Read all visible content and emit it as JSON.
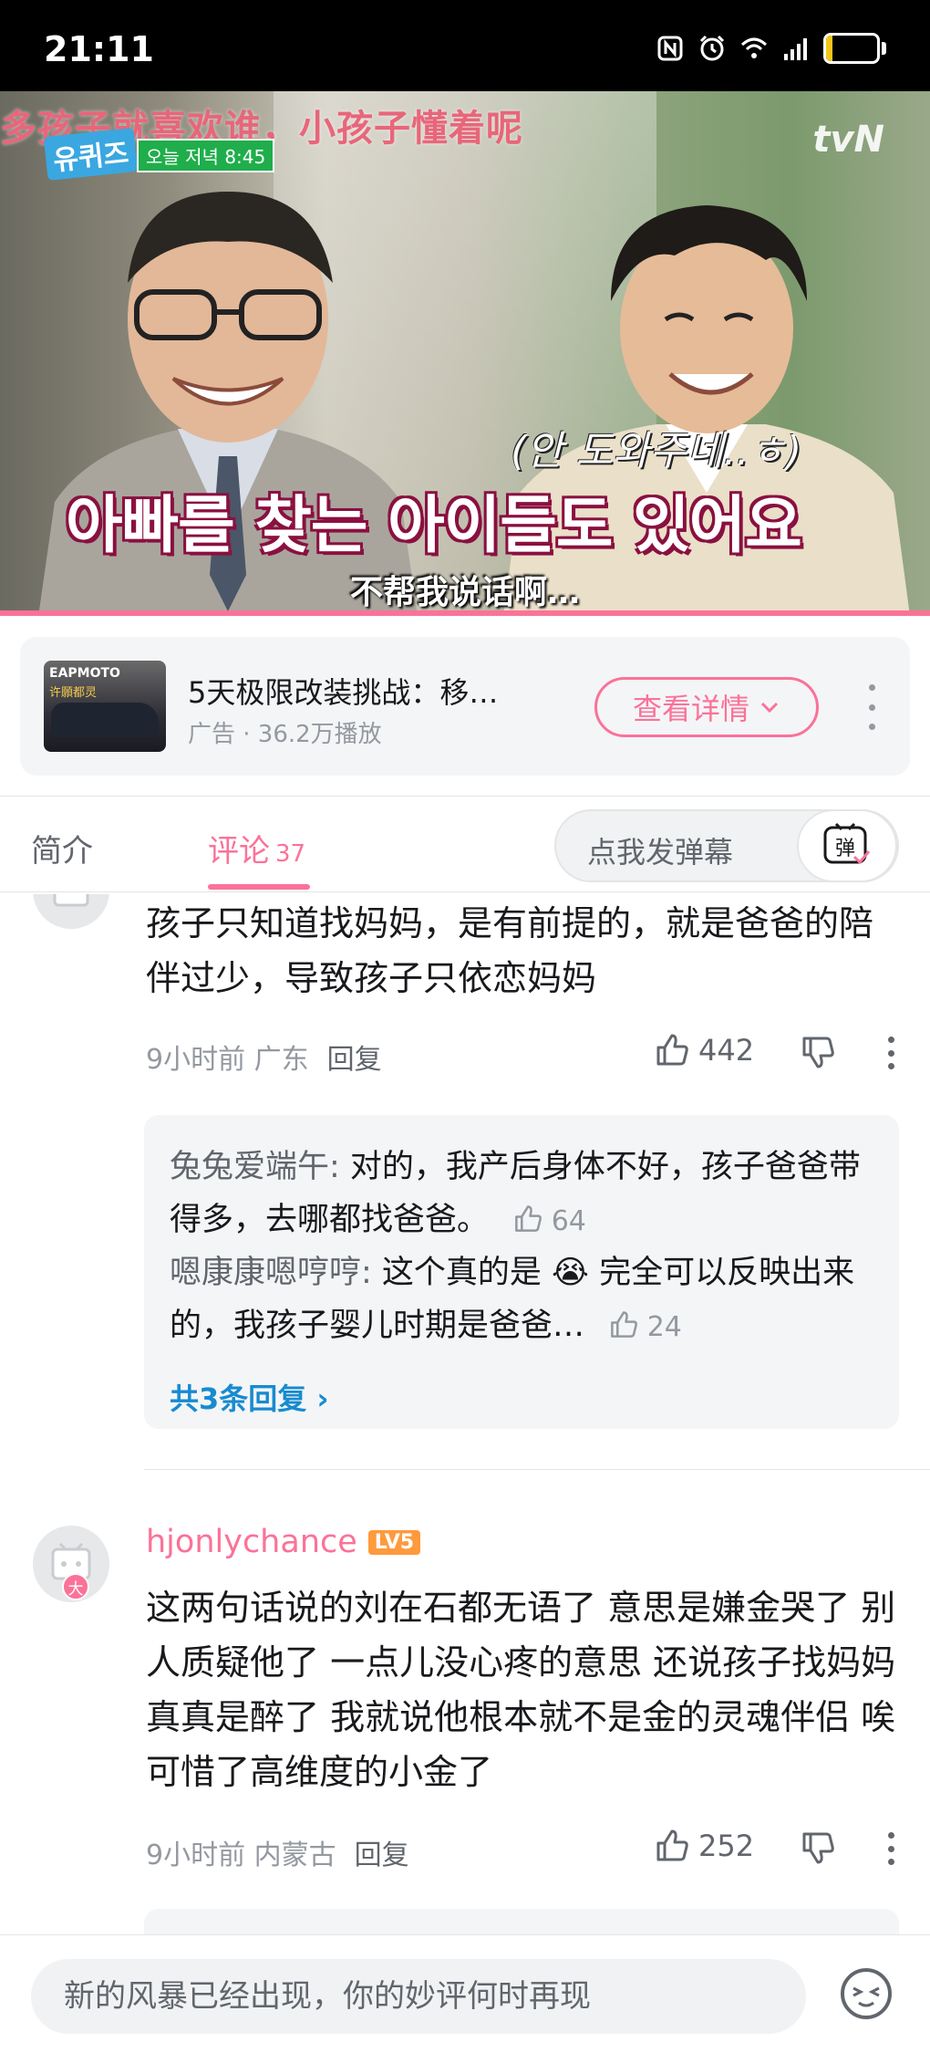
{
  "status_bar": {
    "time": "21:11",
    "battery": "12",
    "battery_fraction": 0.12
  },
  "video": {
    "top_subtitle": "多孩子就喜欢谁，小孩子懂着呢",
    "channel_logo": "tvN",
    "show_logo": "유퀴즈",
    "air_badge": "오늘 저녁 8:45",
    "caption_small": "(안 도와주네..ㅎ)",
    "caption_big": "아빠를 찾는 아이들도 있어요",
    "subtitle_cn": "不帮我说话啊…",
    "progress_fraction": 1.0
  },
  "ad": {
    "thumb_brand": "EAPMOTO",
    "thumb_sub": "许願都灵",
    "title": "5天极限改装挑战：移…",
    "meta": "广告 · 36.2万播放",
    "cta": "查看详情"
  },
  "tabs": {
    "intro": "简介",
    "comments": "评论",
    "comments_count": "37",
    "danmaku_placeholder": "点我发弹幕",
    "danmaku_icon_label": "弹"
  },
  "comments": [
    {
      "text": "孩子只知道找妈妈，是有前提的，就是爸爸的陪伴过少，导致孩子只依恋妈妈",
      "meta": "9小时前 广东",
      "reply_label": "回复",
      "likes": "442",
      "replies": [
        {
          "name": "兔兔爱端午:",
          "text": " 对的，我产后身体不好，孩子爸爸带得多，去哪都找爸爸。",
          "likes": "64"
        },
        {
          "name": "嗯康康嗯哼哼:",
          "text": " 这个真的是 😭 完全可以反映出来的，我孩子婴儿时期是爸爸…",
          "likes": "24"
        }
      ],
      "reply_total": "共3条回复 ›"
    },
    {
      "username": "hjonlychance",
      "level": "LV5",
      "avatar_badge": "大",
      "text": "这两句话说的刘在石都无语了 意思是嫌金哭了 别人质疑他了 一点儿没心疼的意思 还说孩子找妈妈 真真是醉了 我就说他根本就不是金的灵魂伴侣 唉 可惜了高维度的小金了",
      "meta": "9小时前 内蒙古",
      "reply_label": "回复",
      "likes": "252"
    }
  ],
  "bottom_bar": {
    "input_placeholder": "新的风暴已经出现，你的妙评何时再现"
  },
  "colors": {
    "accent": "#fb7299",
    "link": "#178bcf",
    "text": "#18191c",
    "muted": "#9499a0"
  }
}
